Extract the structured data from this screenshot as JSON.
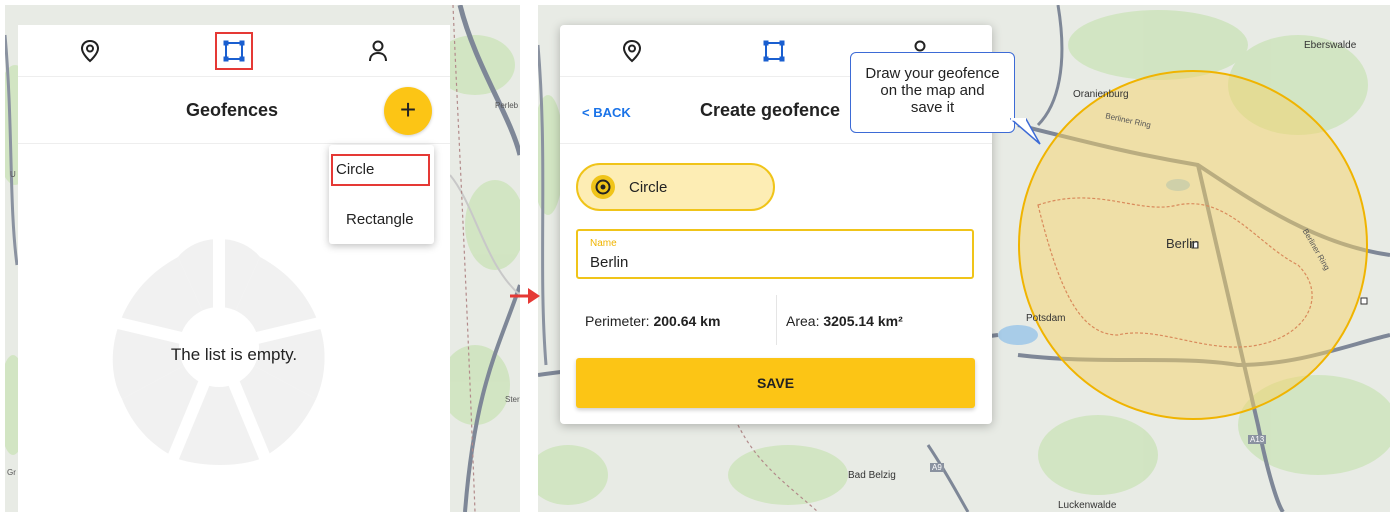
{
  "left_screen": {
    "tabs": [
      {
        "icon": "location-pin-icon"
      },
      {
        "icon": "geofence-polygon-icon",
        "active": true,
        "highlighted": true
      },
      {
        "icon": "user-icon"
      }
    ],
    "title": "Geofences",
    "add_button": "+",
    "dropdown": {
      "items": [
        "Circle",
        "Rectangle"
      ],
      "highlighted": "Circle"
    },
    "empty_message": "The list is empty.",
    "map_labels": [
      "Perleb",
      "Ster",
      "U",
      "Gr"
    ]
  },
  "right_screen": {
    "tabs": [
      {
        "icon": "location-pin-icon"
      },
      {
        "icon": "geofence-polygon-icon",
        "active": true
      },
      {
        "icon": "user-icon"
      }
    ],
    "back_label": "< BACK",
    "title": "Create geofence",
    "shape_selected": "Circle",
    "name_field": {
      "label": "Name",
      "value": "Berlin"
    },
    "perimeter_label": "Perimeter:",
    "perimeter_value": "200.64 km",
    "area_label": "Area:",
    "area_value": "3205.14 km²",
    "save_label": "SAVE",
    "tooltip": [
      "Draw your geofence",
      "on the map and",
      "save it"
    ],
    "map_labels": {
      "eberswalde": "Eberswalde",
      "oranienburg": "Oranienburg",
      "berliner_ring": "Berliner Ring",
      "berliner_ring_2": "Berliner Ring",
      "berlin": "Berlin",
      "potsdam": "Potsdam",
      "bad_belzig": "Bad Belzig",
      "luckenwalde": "Luckenwalde",
      "a13": "A13",
      "a9": "A9"
    }
  },
  "colors": {
    "accent": "#fcc515",
    "accent_light": "#fdedb4",
    "link": "#1a73e8",
    "highlight_border": "#e53935",
    "geofence_fill": "#f5d46a",
    "geofence_stroke": "#f0b400"
  }
}
